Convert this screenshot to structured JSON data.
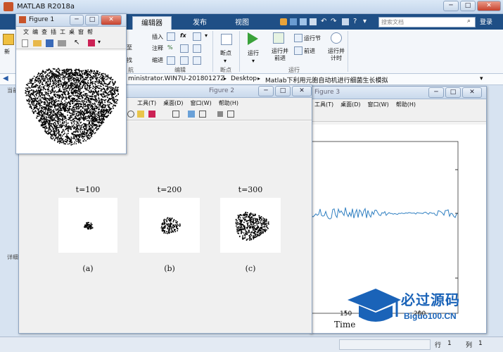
{
  "main_window": {
    "title": "MATLAB R2018a",
    "tabs": [
      "编辑器",
      "发布",
      "视图"
    ],
    "search_placeholder": "搜索文档",
    "login": "登录",
    "min": "─",
    "max": "□",
    "close": "✕"
  },
  "ribbon": {
    "left_partial": [
      "新",
      "",
      ""
    ],
    "items": {
      "insert": "插入",
      "comment": "注释",
      "indent": "缩进",
      "fx": "fx"
    },
    "partial_labels": [
      "至",
      "找"
    ],
    "groups": {
      "edit": "编辑",
      "breakpoints": "断点",
      "run": "运行",
      "partial_left": "航"
    },
    "buttons": {
      "breakpoint": "断点",
      "run": "运行",
      "run_advance": "运行并\n前进",
      "run_section": "运行节",
      "advance": "前进",
      "run_time": "运行并\n计时"
    }
  },
  "address": {
    "segments": [
      "ministrator.WIN7U-20180127Z",
      "Desktop",
      "Matlab下利用元胞自动机进行细菌生长模拟"
    ],
    "left_fragment": "当前",
    "detail_fragment": "详细"
  },
  "figure1": {
    "title": "Figure 1",
    "menu": [
      "文",
      "编",
      "查",
      "插",
      "工",
      "桌",
      "窗",
      "帮"
    ]
  },
  "figure2": {
    "title": "Figure 2",
    "menu": [
      "工具(T)",
      "桌面(D)",
      "窗口(W)",
      "帮助(H)"
    ],
    "panels": [
      {
        "label": "t=100",
        "caption": "(a)",
        "size": 0.25
      },
      {
        "label": "t=200",
        "caption": "(b)",
        "size": 0.55
      },
      {
        "label": "t=300",
        "caption": "(c)",
        "size": 0.95
      }
    ]
  },
  "figure3": {
    "title": "Figure 3",
    "menu": [
      "工具(T)",
      "桌面(D)",
      "窗口(W)",
      "帮助(H)"
    ],
    "xtick": "150",
    "xtick_partial": "200",
    "xlabel": "Time"
  },
  "status": {
    "row_label": "行",
    "row": "1",
    "col_label": "列",
    "col": "1"
  },
  "watermark": {
    "cn": "必过源码",
    "en": "Biguo100.CN"
  },
  "colors": {
    "ribbon_tab_bar": "#1f4f86",
    "line": "#2f7fc1",
    "watermark_blue": "#1a63b8",
    "watermark_red": "#d8221b"
  }
}
